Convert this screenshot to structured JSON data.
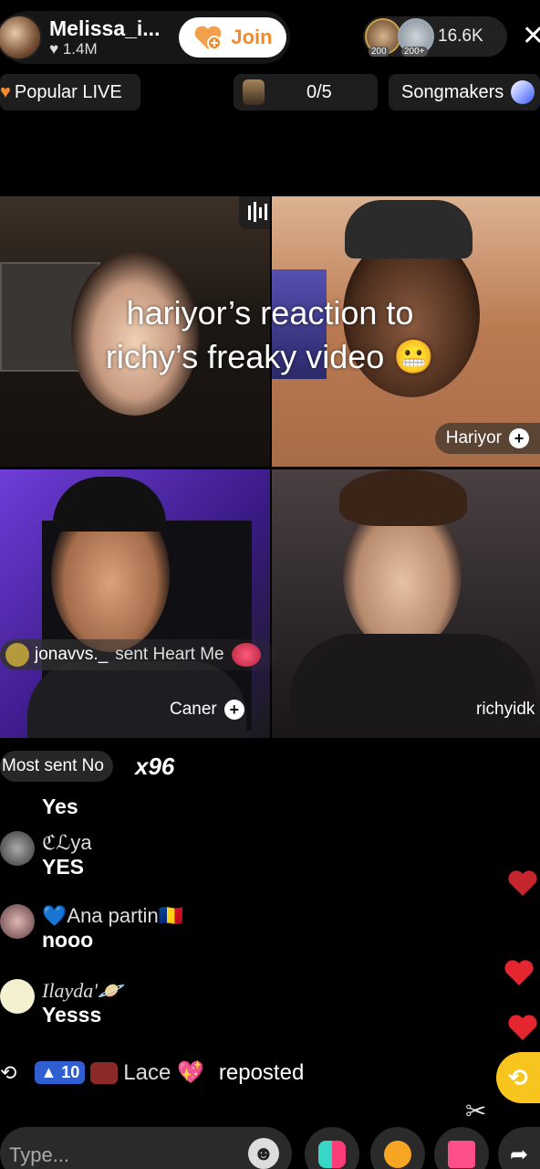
{
  "host": {
    "name": "Melissa_i...",
    "likes": "1.4M",
    "join_label": "Join"
  },
  "viewers": {
    "count": "16.6K",
    "badge1": "200",
    "badge2": "200+"
  },
  "pills": {
    "left": "Popular LIVE",
    "middle": "0/5",
    "right": "Songmakers"
  },
  "caption": {
    "line1": "hariyor’s reaction to",
    "line2": "richy’s freaky video 😬"
  },
  "tiles": {
    "t2_name": "Hariyor",
    "t3_name": "Caner",
    "t4_name": "richyidk"
  },
  "gift_banner": {
    "user": "jonavvs._",
    "text": "sent Heart Me"
  },
  "most_sent": {
    "label": "Most sent No",
    "count": "x96"
  },
  "chat": [
    {
      "name": "",
      "msg": "Yes"
    },
    {
      "name": "ℭℒya",
      "msg": "YES"
    },
    {
      "name": "💙Ana partin🇷🇴",
      "msg": "nooo"
    },
    {
      "name": "Ilayda'🪐",
      "msg": "Yesss"
    }
  ],
  "repost": {
    "badge": "10",
    "name": "Lace 💖",
    "text": "reposted"
  },
  "input": {
    "placeholder": "Type..."
  },
  "colors": {
    "join": "#f08a2c",
    "heart": "#e3262f",
    "repost_btn": "#f7c51d"
  }
}
